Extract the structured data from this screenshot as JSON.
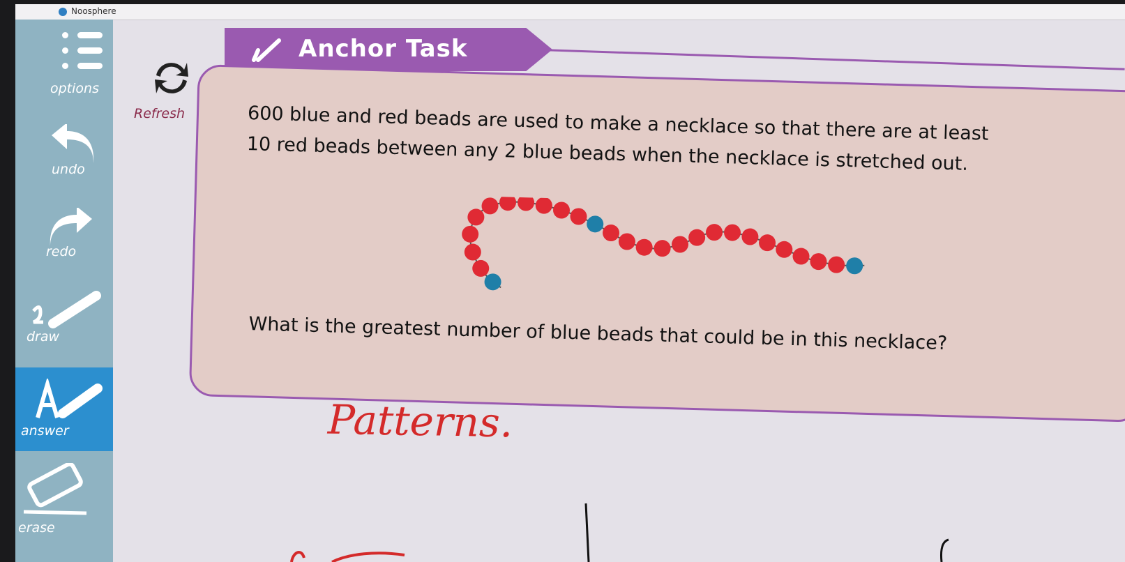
{
  "window": {
    "title": "Noosphere"
  },
  "sidebar": {
    "items": [
      {
        "id": "options",
        "label": "options",
        "icon": "menu-icon"
      },
      {
        "id": "undo",
        "label": "undo",
        "icon": "undo-arrow-icon"
      },
      {
        "id": "redo",
        "label": "redo",
        "icon": "redo-arrow-icon"
      },
      {
        "id": "draw",
        "label": "draw",
        "icon": "pencil-icon"
      },
      {
        "id": "answer",
        "label": "answer",
        "icon": "text-pencil-icon",
        "active": true
      },
      {
        "id": "erase",
        "label": "erase",
        "icon": "eraser-icon"
      }
    ]
  },
  "refresh": {
    "label": "Refresh",
    "icon": "refresh-icon"
  },
  "task": {
    "title": "Anchor Task",
    "question_line1": "600 blue and red beads are used to make a necklace so that there are at least",
    "question_line2": "10 red beads between any 2 blue beads when the necklace is stretched out.",
    "question_final": "What is the greatest number of blue beads that could be in this necklace?"
  },
  "handwriting": {
    "text": "Patterns."
  },
  "colors": {
    "accent": "#9a5ab0",
    "sidebar": "#8fb3c2",
    "sidebar_active": "#2c8fcf",
    "red_bead": "#e02a34",
    "blue_bead": "#1f7fa8",
    "ink": "#d42a2a"
  }
}
